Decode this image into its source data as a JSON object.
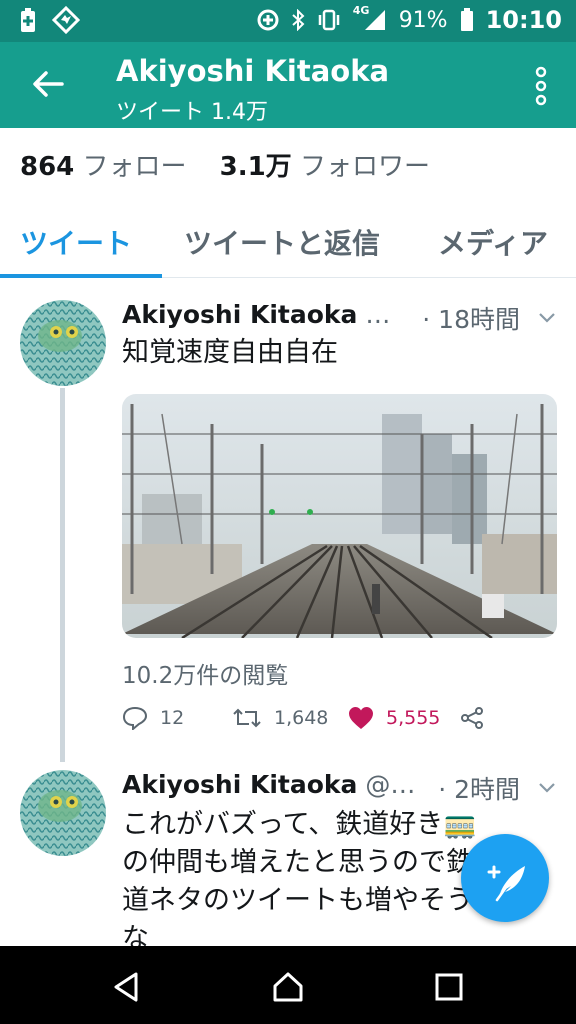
{
  "status_bar": {
    "battery_percent": "91%",
    "time": "10:10",
    "network": "4G",
    "icons": [
      "battery-saver-icon",
      "app-notification-icon",
      "data-saver-icon",
      "bluetooth-icon",
      "vibrate-icon",
      "signal-icon",
      "battery-icon"
    ]
  },
  "header": {
    "title": "Akiyoshi Kitaoka",
    "subtitle": "ツイート 1.4万",
    "accent_color": "#169e8e"
  },
  "profile_stats": {
    "following_count": "864",
    "following_label": "フォロー",
    "followers_count": "3.1万",
    "followers_label": "フォロワー"
  },
  "tabs": [
    {
      "label": "ツイート",
      "active": true
    },
    {
      "label": "ツイートと返信",
      "active": false
    },
    {
      "label": "メディア",
      "active": false
    }
  ],
  "tweets": [
    {
      "name": "Akiyoshi Kitaoka",
      "handle": "…",
      "time": "· 18時間",
      "text": "知覚速度自由自在",
      "views": "10.2万件の閲覧",
      "replies": "12",
      "retweets": "1,648",
      "likes": "5,555",
      "liked": true
    },
    {
      "name": "Akiyoshi Kitaoka",
      "handle": "@…",
      "time": "· 2時間",
      "text_lines": [
        "これがバズって、鉄道好き🚃",
        "の仲間も増えたと思うので鉄",
        "道ネタのツイートも増やそうか",
        "な"
      ]
    }
  ],
  "colors": {
    "like": "#c2185b",
    "link": "#1b95e0",
    "fab": "#1da1f2"
  }
}
